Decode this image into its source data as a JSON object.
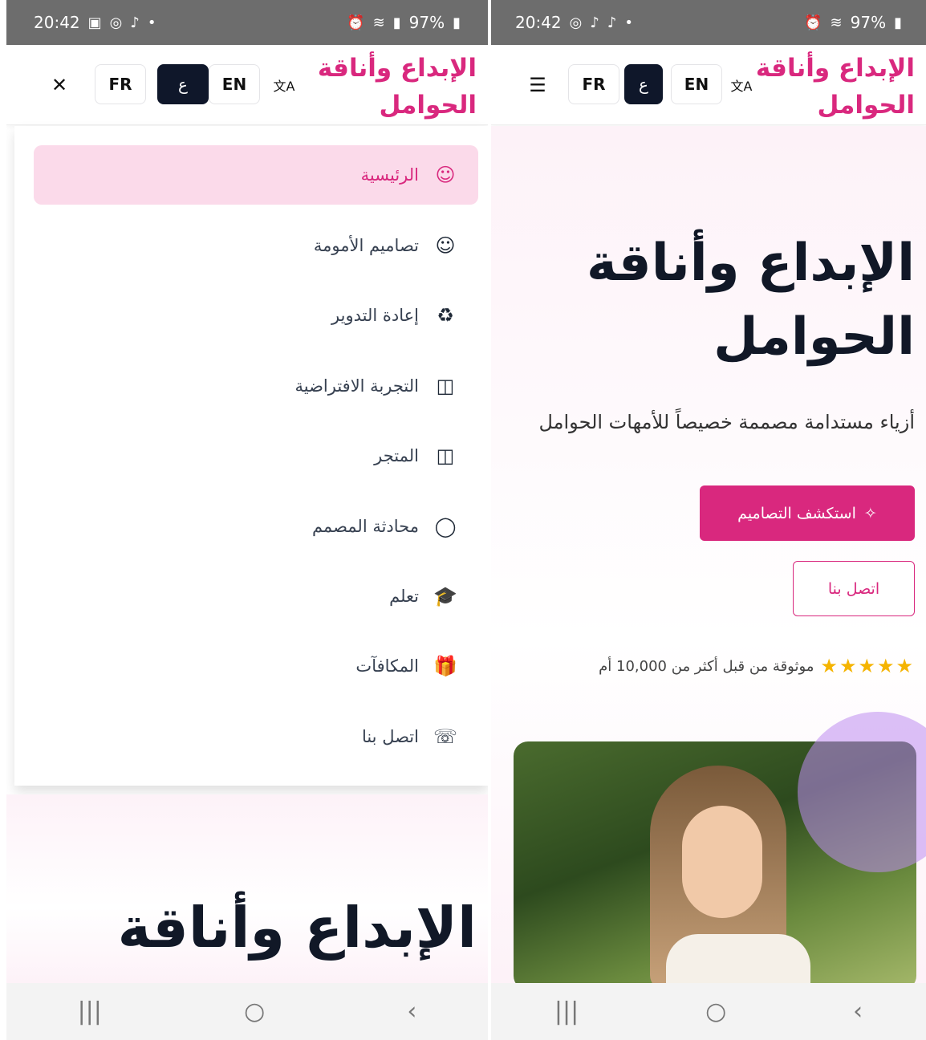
{
  "status_bar": {
    "time": "20:42",
    "battery": "97%"
  },
  "header": {
    "brand": "الإبداع وأناقة الحوامل",
    "lang_fr": "FR",
    "lang_ar": "ع",
    "lang_en": "EN",
    "translate_icon": "文A",
    "close_icon": "✕",
    "menu_icon": "☰"
  },
  "menu": {
    "items": [
      {
        "label": "الرئيسية",
        "icon": "baby-face-icon",
        "glyph": "☺"
      },
      {
        "label": "تصاميم الأمومة",
        "icon": "baby-face-icon",
        "glyph": "☺"
      },
      {
        "label": "إعادة التدوير",
        "icon": "recycle-icon",
        "glyph": "♻"
      },
      {
        "label": "التجربة الافتراضية",
        "icon": "shopping-bag-icon",
        "glyph": "◫"
      },
      {
        "label": "المتجر",
        "icon": "shopping-bag-icon",
        "glyph": "◫"
      },
      {
        "label": "محادثة المصمم",
        "icon": "chat-bubble-icon",
        "glyph": "◯"
      },
      {
        "label": "تعلم",
        "icon": "graduation-cap-icon",
        "glyph": "🎓"
      },
      {
        "label": "المكافآت",
        "icon": "gift-icon",
        "glyph": "🎁"
      },
      {
        "label": "اتصل بنا",
        "icon": "phone-icon",
        "glyph": "☏"
      }
    ]
  },
  "hero": {
    "title_line1": "الإبداع وأناقة",
    "title_line2": "الحوامل",
    "subtitle": "أزياء مستدامة مصممة خصيصاً للأمهات الحوامل",
    "primary_button": "استكشف التصاميم",
    "secondary_button": "اتصل بنا",
    "trust_text": "موثوقة من قبل أكثر من 10,000 أم",
    "stars": "★★★★★",
    "rating_stars": 5
  },
  "nav": {
    "recents": "|||",
    "home": "○",
    "back": "‹"
  },
  "colors": {
    "brand_pink": "#d9287e",
    "active_lang": "#0f172a",
    "active_menu_bg": "#fbdaea",
    "star": "#f5b400"
  }
}
